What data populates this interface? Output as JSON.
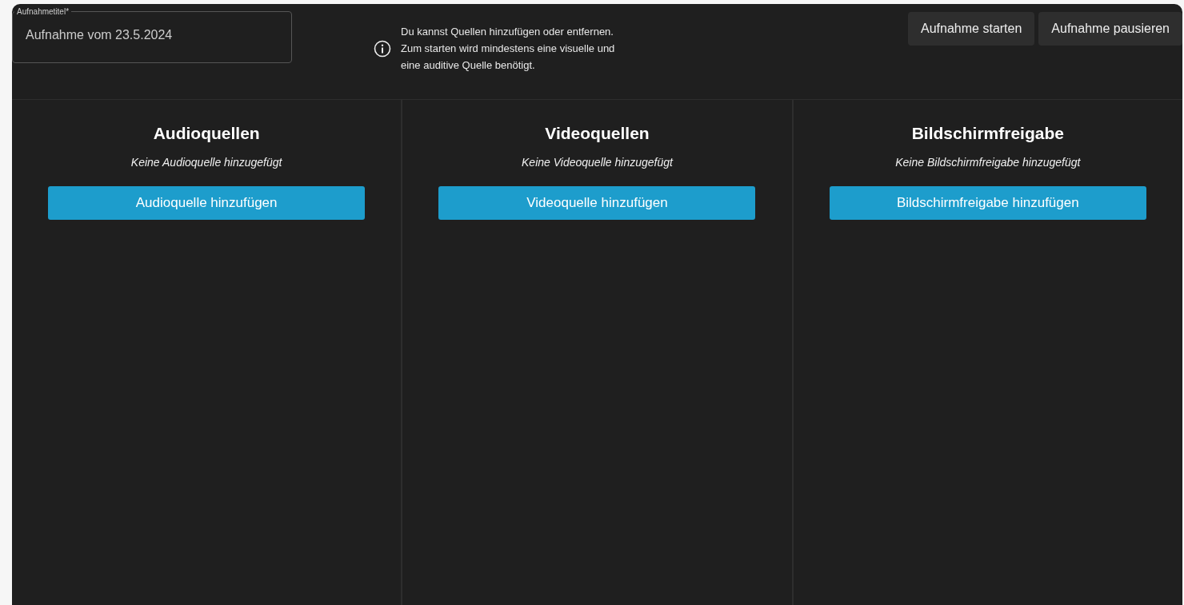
{
  "title_field": {
    "label": "Aufnahmetitel*",
    "value": "Aufnahme vom 23.5.2024"
  },
  "info": "Du kannst Quellen hinzufügen oder entfernen. Zum starten wird mindestens eine visuelle und eine auditive Quelle benötigt.",
  "buttons": [
    "Aufnahme starten",
    "Aufnahme pausieren"
  ],
  "columns": [
    {
      "heading": "Audioquellen",
      "empty_text": "Keine Audioquelle hinzugefügt",
      "button": "Audioquelle hinzufügen"
    },
    {
      "heading": "Videoquellen",
      "empty_text": "Keine Videoquelle hinzugefügt",
      "button": "Videoquelle hinzufügen"
    },
    {
      "heading": "Bildschirmfreigabe",
      "empty_text": "Keine Bildschirmfreigabe hinzugefügt",
      "button": "Bildschirmfreigabe hinzufügen"
    }
  ]
}
